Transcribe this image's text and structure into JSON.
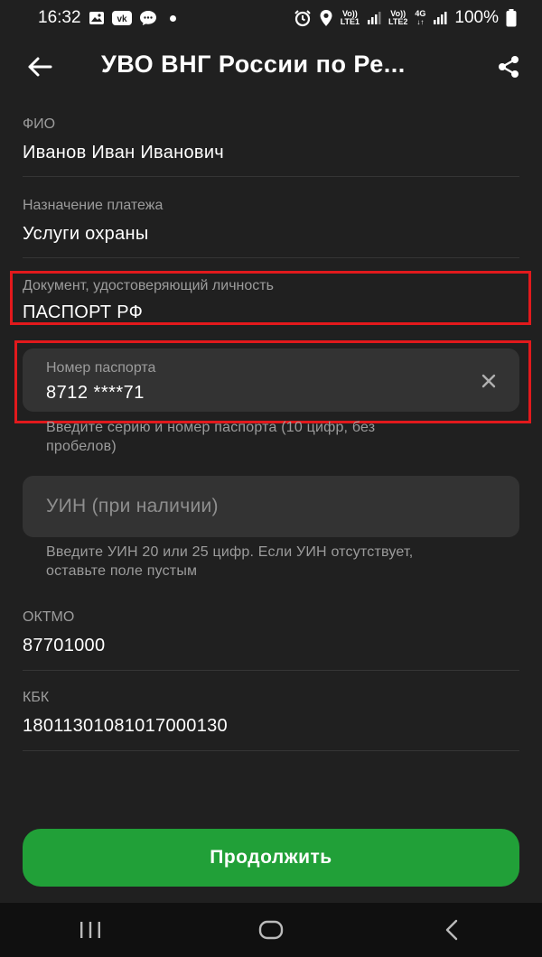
{
  "status_bar": {
    "time": "16:32",
    "battery": "100%",
    "sim1_top": "Vo))",
    "sim1_bottom": "LTE1",
    "sim2_top": "Vo))",
    "sim2_bottom": "LTE2",
    "network": "4G",
    "notification_icons": [
      "gallery-icon",
      "vk-icon",
      "chat-icon",
      "dot-icon"
    ],
    "system_icons": [
      "alarm-icon",
      "location-icon",
      "signal-icon",
      "signal-icon",
      "battery-icon"
    ]
  },
  "header": {
    "title": "УВО ВНГ России по Ре..."
  },
  "fields": {
    "fio_label": "ФИО",
    "fio_value": "Иванов Иван Иванович",
    "purpose_label": "Назначение платежа",
    "purpose_value": "Услуги охраны",
    "doc_label": "Документ, удостоверяющий личность",
    "doc_value": "ПАСПОРТ РФ",
    "oktmo_label": "ОКТМО",
    "oktmo_value": "87701000",
    "kbk_label": "КБК",
    "kbk_value": "18011301081017000130"
  },
  "passport_input": {
    "label": "Номер паспорта",
    "value": "8712 ****71",
    "hint_line1": "Введите серию и номер паспорта (10 цифр, без",
    "hint_line2": "пробелов)"
  },
  "uin_input": {
    "placeholder": "УИН (при наличии)",
    "hint_line1": "Введите УИН 20 или 25 цифр. Если УИН отсутствует,",
    "hint_line2": "оставьте поле пустым"
  },
  "actions": {
    "continue_label": "Продолжить"
  },
  "colors": {
    "background": "#202020",
    "accent_green": "#21a038",
    "highlight_red": "#e2191c",
    "input_bg": "#333333"
  }
}
